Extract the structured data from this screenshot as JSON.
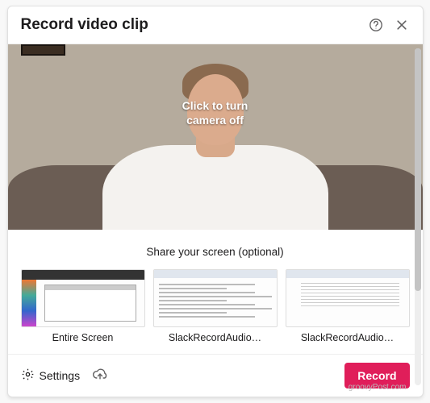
{
  "header": {
    "title": "Record video clip"
  },
  "camera": {
    "overlay_line1": "Click to turn",
    "overlay_line2": "camera off"
  },
  "share": {
    "title": "Share your screen (optional)",
    "options": [
      {
        "label": "Entire Screen"
      },
      {
        "label": "SlackRecordAudio…"
      },
      {
        "label": "SlackRecordAudio…"
      }
    ]
  },
  "footer": {
    "settings_label": "Settings",
    "record_label": "Record"
  },
  "watermark": "groovyPost.com"
}
